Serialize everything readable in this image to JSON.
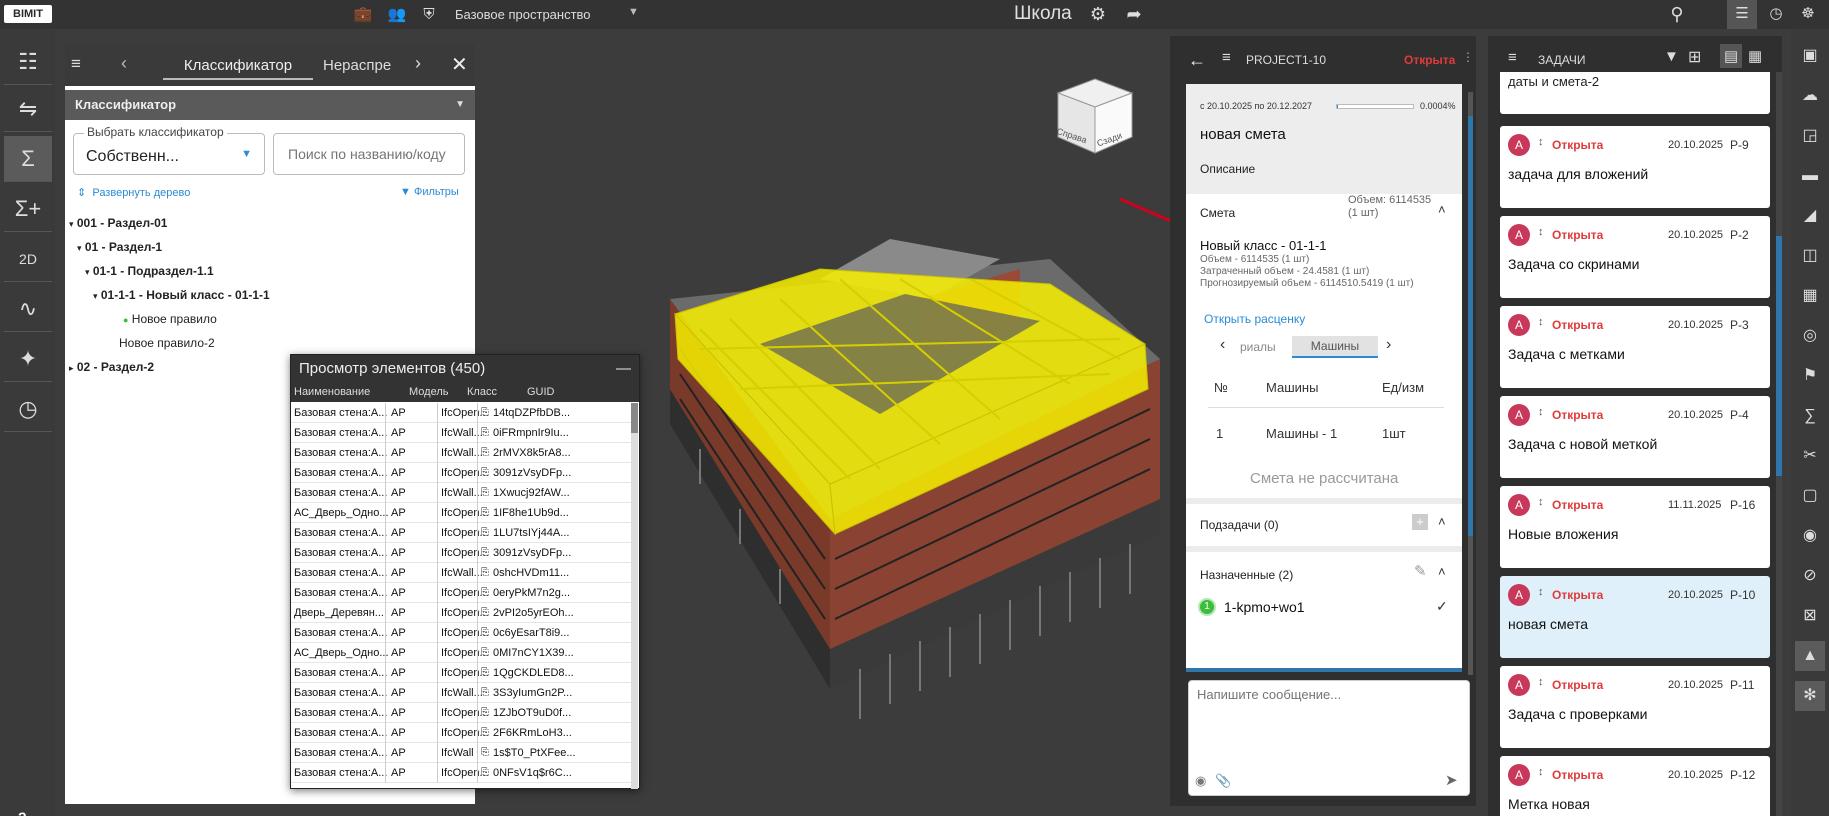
{
  "app": {
    "logo": "BIMIT",
    "space": "Базовое пространство",
    "project_title": "Школа"
  },
  "left_tools": [
    "classifier-tree-icon",
    "shuffle-icon",
    "sum-icon",
    "sum-plus-icon",
    "2d-icon",
    "chart-line-icon",
    "puzzle-icon",
    "gauge-icon"
  ],
  "help_label": "?",
  "classifier": {
    "tab_active": "Классификатор",
    "tab_next": "Нераспре",
    "section_title": "Классификатор",
    "select_label": "Выбрать классификатор",
    "select_value": "Собственн...",
    "search_placeholder": "Поиск по названию/коду",
    "expand_label": "Развернуть дерево",
    "filters_label": "Фильтры",
    "tree": [
      {
        "label": "001 - Раздел-01",
        "bold": true,
        "level": 0,
        "arrow": "▾"
      },
      {
        "label": "01 - Раздел-1",
        "bold": true,
        "level": 1,
        "arrow": "▾"
      },
      {
        "label": "01-1 - Подраздел-1.1",
        "bold": true,
        "level": 2,
        "arrow": "▾"
      },
      {
        "label": "01-1-1 - Новый класс - 01-1-1",
        "bold": true,
        "level": 3,
        "arrow": "▾"
      },
      {
        "label": "Новое правило",
        "bold": false,
        "level": 4,
        "dot": true
      },
      {
        "label": "Новое правило-2",
        "bold": false,
        "level": 4
      },
      {
        "label": "02 - Раздел-2",
        "bold": true,
        "level": 0,
        "arrow": "▸"
      }
    ]
  },
  "elements": {
    "title": "Просмотр элементов (450)",
    "columns": [
      "Наименование",
      "Модель",
      "Класс",
      "GUID"
    ],
    "rows": [
      [
        "Базовая стена:А...",
        "АР",
        "IfcOpen...",
        "14tqDZPfbDB..."
      ],
      [
        "Базовая стена:А...",
        "АР",
        "IfcWall...",
        "0iFRmpnIr9Iu..."
      ],
      [
        "Базовая стена:А...",
        "АР",
        "IfcWall...",
        "2rMVX8k5rA8..."
      ],
      [
        "Базовая стена:А...",
        "АР",
        "IfcOpen...",
        "3091zVsyDFp..."
      ],
      [
        "Базовая стена:А...",
        "АР",
        "IfcWall...",
        "1Xwucj92fAW..."
      ],
      [
        "АС_Дверь_Одно...",
        "АР",
        "IfcOpen...",
        "1IF8he1Ub9d..."
      ],
      [
        "Базовая стена:А...",
        "АР",
        "IfcOpen...",
        "1LU7tsIYj44A..."
      ],
      [
        "Базовая стена:А...",
        "АР",
        "IfcOpen...",
        "3091zVsyDFp..."
      ],
      [
        "Базовая стена:А...",
        "АР",
        "IfcWall...",
        "0shcHVDm11..."
      ],
      [
        "Базовая стена:А...",
        "АР",
        "IfcOpen...",
        "0eryPkM7n2g..."
      ],
      [
        "Дверь_Деревян...",
        "АР",
        "IfcOpen...",
        "2vPI2o5yrEOh..."
      ],
      [
        "Базовая стена:А...",
        "АР",
        "IfcOpen...",
        "0c6yEsarT8i9..."
      ],
      [
        "АС_Дверь_Одно...",
        "АР",
        "IfcOpen...",
        "0MI7nCY1X39..."
      ],
      [
        "Базовая стена:А...",
        "АР",
        "IfcOpen...",
        "1QgCKDLED8..."
      ],
      [
        "Базовая стена:А...",
        "АР",
        "IfcWall...",
        "3S3yIumGn2P..."
      ],
      [
        "Базовая стена:А...",
        "АР",
        "IfcOpen...",
        "1ZJbOT9uD0f..."
      ],
      [
        "Базовая стена:А...",
        "АР",
        "IfcOpen...",
        "2F6KRmLoH3..."
      ],
      [
        "Базовая стена:А...",
        "АР",
        "IfcWall",
        "1s$T0_PtXFee..."
      ],
      [
        "Базовая стена:А...",
        "АР",
        "IfcOpen...",
        "0NFsV1q$r6C..."
      ]
    ]
  },
  "viewer": {
    "cube_left": "Сзади",
    "cube_right": "Справа"
  },
  "task_detail": {
    "project": "PROJECT1-10",
    "status": "Открыта",
    "dates": "с 20.10.2025 по 20.12.2027",
    "progress_label": "0.0004%",
    "progress": 4e-06,
    "title": "новая смета",
    "description_label": "Описание",
    "estimate_label": "Смета",
    "volume": "Объем: 6114535 (1 шт)",
    "class_title": "Новый класс - 01-1-1",
    "class_volume": "Объем - 6114535 (1 шт)",
    "spent_volume": "Затраченный объем - 24.4581 (1 шт)",
    "forecast_volume": "Прогнозируемый объем - 6114510.5419 (1 шт)",
    "open_rate": "Открыть расценку",
    "sub_tab_prev": "риалы",
    "sub_tab_active": "Машины",
    "col_no": "№",
    "col_machines": "Машины",
    "col_unit": "Ед/изм",
    "row_no": "1",
    "row_machine": "Машины - 1",
    "row_unit": "1шт",
    "not_calculated": "Смета не рассчитана",
    "subtasks": "Подзадачи (0)",
    "assigned": "Назначенные (2)",
    "assignee": "1-kpmo+wo1",
    "assignee_num": "1",
    "message_placeholder": "Напишите сообщение..."
  },
  "tasks": {
    "title": "ЗАДАЧИ",
    "partial_top": "даты и смета-2",
    "items": [
      {
        "avatar": "A",
        "status": "Открыта",
        "date": "20.10.2025",
        "id": "P-9",
        "title": "задача для вложений"
      },
      {
        "avatar": "A",
        "status": "Открыта",
        "date": "20.10.2025",
        "id": "P-2",
        "title": "Задача со скринами"
      },
      {
        "avatar": "A",
        "status": "Открыта",
        "date": "20.10.2025",
        "id": "P-3",
        "title": "Задача с метками"
      },
      {
        "avatar": "A",
        "status": "Открыта",
        "date": "20.10.2025",
        "id": "P-4",
        "title": "Задача с новой меткой"
      },
      {
        "avatar": "A",
        "status": "Открыта",
        "date": "11.11.2025",
        "id": "P-16",
        "title": "Новые вложения"
      },
      {
        "avatar": "A",
        "status": "Открыта",
        "date": "20.10.2025",
        "id": "P-10",
        "title": "новая смета",
        "selected": true
      },
      {
        "avatar": "A",
        "status": "Открыта",
        "date": "20.10.2025",
        "id": "P-11",
        "title": "Задача с проверками"
      },
      {
        "avatar": "A",
        "status": "Открыта",
        "date": "20.10.2025",
        "id": "P-12",
        "title": "Метка новая"
      }
    ]
  },
  "right_tools": [
    "focus-icon",
    "cloud-icon",
    "zoom-region-icon",
    "ruler-icon",
    "section-plane-icon",
    "section-box-icon",
    "grid-plan-icon",
    "target-icon",
    "flag-icon",
    "st-icon",
    "cut-icon",
    "box-icon",
    "eye-icon",
    "eye-off-icon",
    "clip-icon",
    "cube-icon",
    "navigation-icon"
  ],
  "colors": {
    "accent": "#2a8ad4",
    "status_open": "#e03b3b",
    "model_highlight": "#f7f000",
    "panel_dark": "#2f2f2f",
    "avatar": "#c7385a"
  }
}
